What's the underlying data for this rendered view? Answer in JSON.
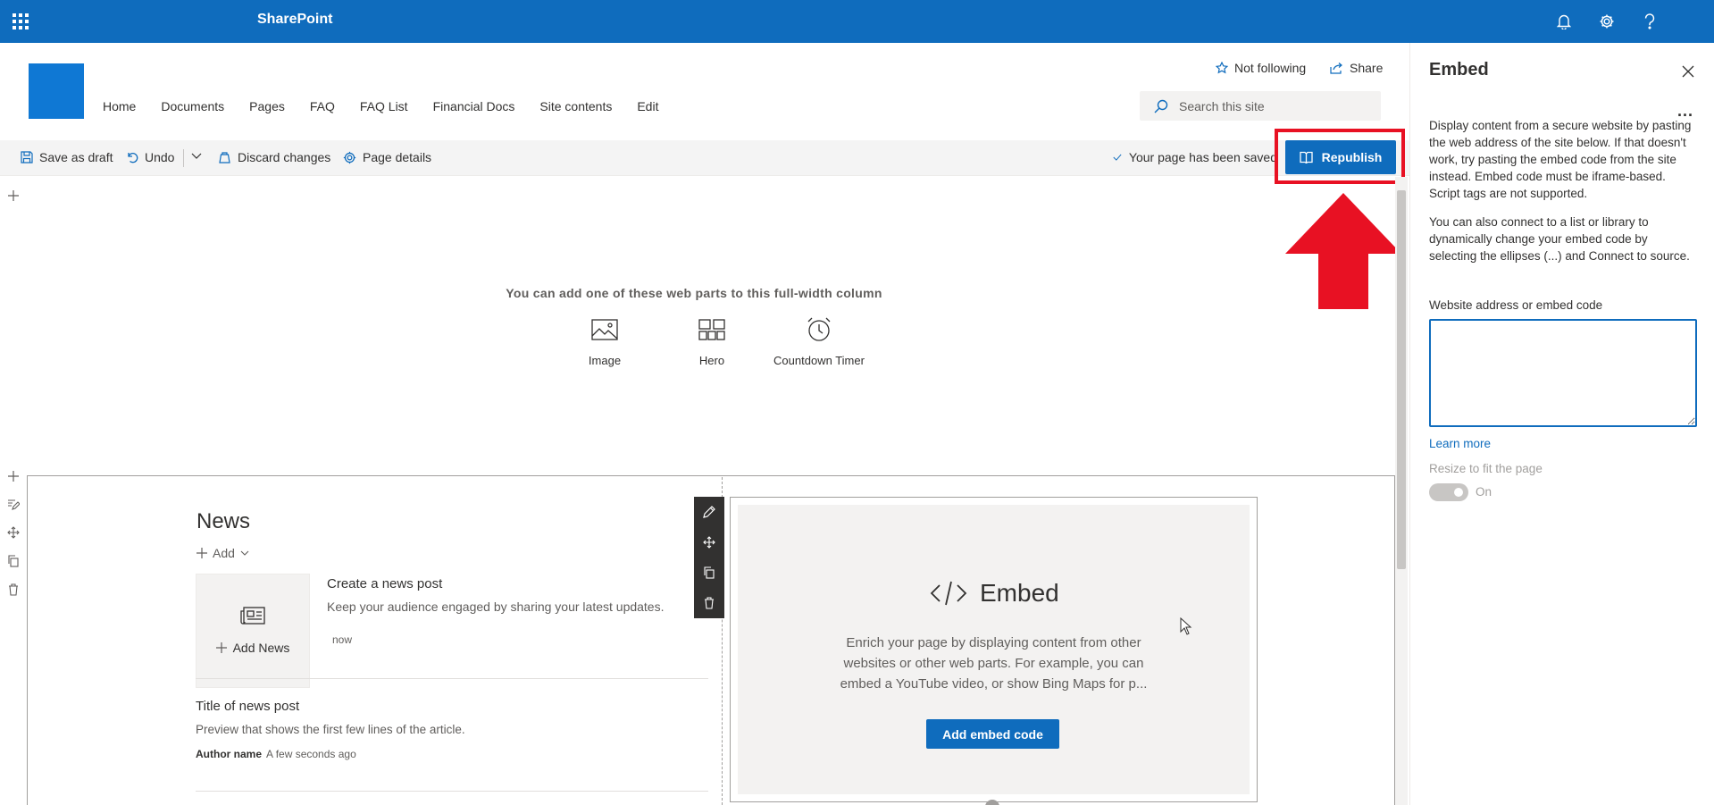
{
  "suite": {
    "app_title": "SharePoint",
    "icons": [
      "waffle-icon",
      "bell-icon",
      "gear-icon",
      "help-icon"
    ]
  },
  "site": {
    "nav": [
      "Home",
      "Documents",
      "Pages",
      "FAQ",
      "FAQ List",
      "Financial Docs",
      "Site contents",
      "Edit"
    ],
    "follow_label": "Not following",
    "share_label": "Share",
    "search_placeholder": "Search this site"
  },
  "commandbar": {
    "save_draft": "Save as draft",
    "undo": "Undo",
    "discard": "Discard changes",
    "page_details": "Page details",
    "saved_status": "Your page has been saved",
    "republish": "Republish"
  },
  "canvas": {
    "fullwidth_hint": "You can add one of these web parts to this full-width column",
    "webpart_options": [
      "Image",
      "Hero",
      "Countdown Timer"
    ],
    "news": {
      "title": "News",
      "add_label": "Add",
      "add_news_label": "Add News",
      "create_title": "Create a news post",
      "create_desc": "Keep your audience engaged by sharing your latest updates.",
      "create_time": "now",
      "post_title": "Title of news post",
      "post_preview": "Preview that shows the first few lines of the article.",
      "post_author": "Author name",
      "post_time": "A few seconds ago"
    },
    "embed": {
      "title": "Embed",
      "description": "Enrich your page by displaying content from other websites or other web parts. For example, you can embed a YouTube video, or show Bing Maps for p...",
      "button": "Add embed code"
    }
  },
  "pane": {
    "title": "Embed",
    "more": "...",
    "para1": "Display content from a secure website by pasting the web address of the site below. If that doesn't work, try pasting the embed code from the site instead. Embed code must be iframe-based. Script tags are not supported.",
    "para2": "You can also connect to a list or library to dynamically change your embed code by selecting the ellipses (...) and Connect to source.",
    "field_label": "Website address or embed code",
    "field_value": "",
    "learn_more": "Learn more",
    "resize_label": "Resize to fit the page",
    "toggle_text": "On",
    "toggle_on": true
  },
  "colors": {
    "brand": "#0f6cbd",
    "highlight": "#e81123"
  }
}
